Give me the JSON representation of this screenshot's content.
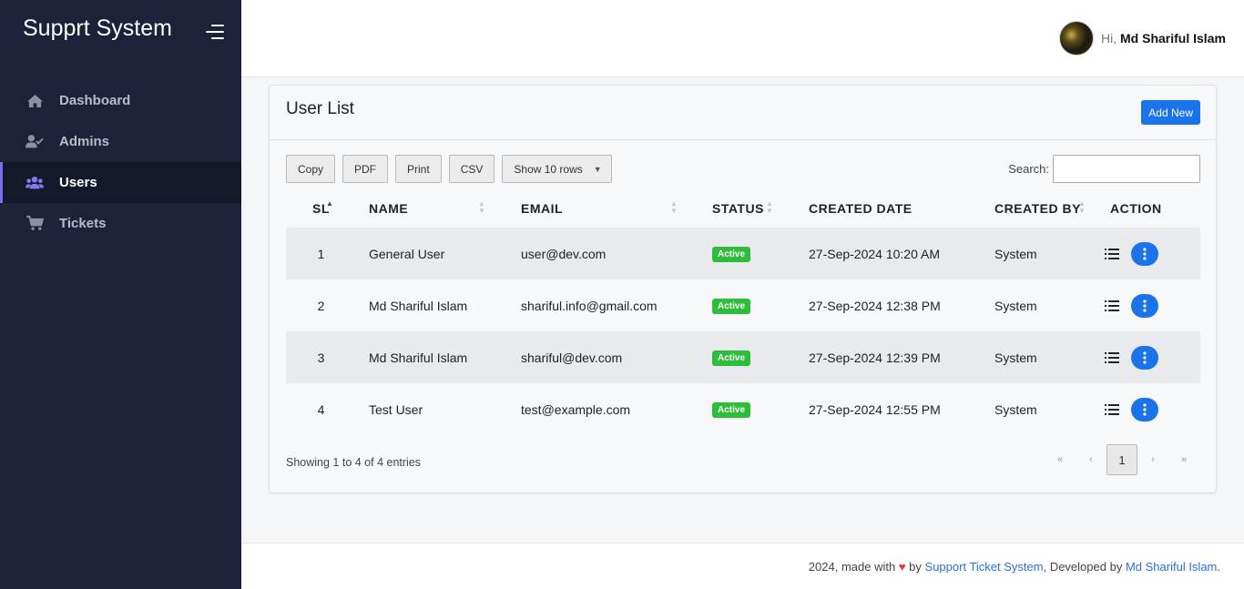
{
  "app": {
    "title": "Supprt System"
  },
  "sidebar": {
    "items": [
      {
        "label": "Dashboard",
        "icon": "home-icon"
      },
      {
        "label": "Admins",
        "icon": "user-check-icon"
      },
      {
        "label": "Users",
        "icon": "users-icon",
        "active": true
      },
      {
        "label": "Tickets",
        "icon": "cart-icon"
      }
    ]
  },
  "header": {
    "greeting": "Hi,",
    "user_name": "Md Shariful Islam"
  },
  "card": {
    "title": "User List",
    "add_label": "Add New",
    "toolbar": {
      "copy": "Copy",
      "pdf": "PDF",
      "print": "Print",
      "csv": "CSV",
      "rows": "Show 10 rows"
    },
    "search_label": "Search:",
    "search_value": ""
  },
  "table": {
    "headers": [
      "SL",
      "NAME",
      "EMAIL",
      "STATUS",
      "CREATED DATE",
      "CREATED BY",
      "ACTION"
    ],
    "rows": [
      {
        "sl": "1",
        "name": "General User",
        "email": "user@dev.com",
        "status": "Active",
        "created": "27-Sep-2024 10:20 AM",
        "by": "System"
      },
      {
        "sl": "2",
        "name": "Md Shariful Islam",
        "email": "shariful.info@gmail.com",
        "status": "Active",
        "created": "27-Sep-2024 12:38 PM",
        "by": "System"
      },
      {
        "sl": "3",
        "name": "Md Shariful Islam",
        "email": "shariful@dev.com",
        "status": "Active",
        "created": "27-Sep-2024 12:39 PM",
        "by": "System"
      },
      {
        "sl": "4",
        "name": "Test User",
        "email": "test@example.com",
        "status": "Active",
        "created": "27-Sep-2024 12:55 PM",
        "by": "System"
      }
    ]
  },
  "pagination": {
    "info": "Showing 1 to 4 of 4 entries",
    "first": "«",
    "prev": "‹",
    "current": "1",
    "next": "›",
    "last": "»"
  },
  "footer": {
    "prefix": "2024, made with",
    "heart": "♥",
    "by": "by",
    "link1": "Support Ticket System",
    "mid": ", Developed by",
    "link2": "Md Shariful Islam",
    "end": "."
  },
  "colors": {
    "sidebar": "#1e2139",
    "accent": "#1a73e8",
    "badge": "#2ebd3a",
    "active_indicator": "#7a6cf0"
  }
}
